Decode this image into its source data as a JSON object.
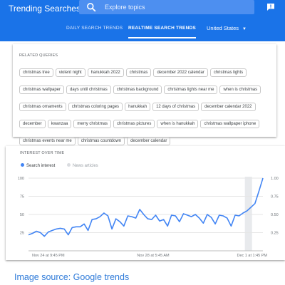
{
  "header": {
    "app_title": "Trending Searches",
    "search_placeholder": "Explore topics",
    "tabs": [
      {
        "label": "DAILY SEARCH TRENDS",
        "active": false
      },
      {
        "label": "REALTIME SEARCH TRENDS",
        "active": true
      }
    ],
    "country": "United States"
  },
  "related": {
    "heading": "RELATED QUERIES",
    "queries": [
      "christmas tree",
      "violent night",
      "hanukkah 2022",
      "christmas",
      "december 2022 calendar",
      "christmas lights",
      "christmas wallpaper",
      "days until christmas",
      "christmas background",
      "christmas lights near me",
      "when is christmas",
      "christmas ornaments",
      "christmas coloring pages",
      "hanukkah",
      "12 days of christmas",
      "december calendar 2022",
      "december",
      "kwanzaa",
      "merry christmas",
      "christmas pictures",
      "when is hanukkah",
      "christmas wallpaper iphone",
      "christmas events near me",
      "christmas countdown",
      "december calendar"
    ]
  },
  "interest": {
    "heading": "INTEREST OVER TIME",
    "legend": [
      {
        "label": "Search interest",
        "color": "#4285f4"
      },
      {
        "label": "News articles",
        "color": "#dadce0"
      }
    ]
  },
  "colors": {
    "brand": "#1a73e8",
    "series": "#4285f4",
    "caption": "#2f7bd9"
  },
  "chart_data": {
    "type": "line",
    "title": "",
    "x": [
      "Nov 24 at 9:45 PM",
      "Nov 28 at 5:45 AM",
      "Dec 1 at 1:45 PM"
    ],
    "left_axis_ticks": [
      25,
      50,
      75,
      100
    ],
    "right_axis_ticks": [
      "0.25",
      "0.50",
      "0.75",
      "1.00"
    ],
    "ylim": [
      0,
      100
    ],
    "grid": true,
    "series": [
      {
        "name": "Search interest",
        "values": [
          22,
          24,
          27,
          25,
          20,
          26,
          28,
          30,
          31,
          30,
          22,
          32,
          33,
          33,
          37,
          28,
          43,
          44,
          47,
          52,
          48,
          30,
          44,
          40,
          34,
          48,
          47,
          45,
          57,
          50,
          44,
          43,
          49,
          41,
          43,
          34,
          49,
          48,
          40,
          51,
          49,
          47,
          50,
          45,
          38,
          50,
          46,
          37,
          49,
          48,
          45,
          34,
          49,
          48,
          52,
          55,
          60,
          65,
          82,
          100
        ]
      }
    ]
  },
  "caption": "Image source: Google trends"
}
